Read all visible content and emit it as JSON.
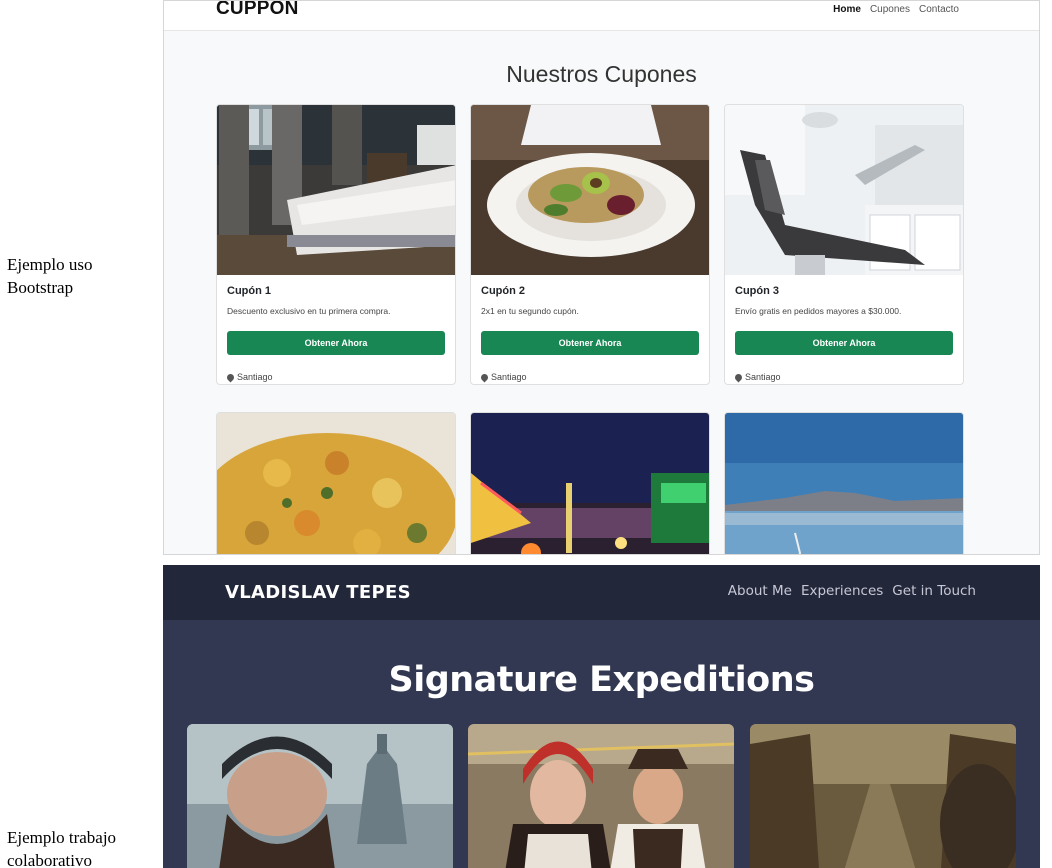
{
  "labels": {
    "bootstrap_line1": "Ejemplo uso",
    "bootstrap_line2": "Bootstrap",
    "collab_line1": "Ejemplo trabajo",
    "collab_line2": "colaborativo"
  },
  "cuppon": {
    "brand": "CUPPON",
    "nav": [
      "Home",
      "Cupones",
      "Contacto"
    ],
    "title": "Nuestros Cupones",
    "cards": [
      {
        "title": "Cupón 1",
        "text": "Descuento exclusivo en tu primera compra.",
        "button": "Obtener Ahora",
        "location": "Santiago"
      },
      {
        "title": "Cupón 2",
        "text": "2x1 en tu segundo cupón.",
        "button": "Obtener Ahora",
        "location": "Santiago"
      },
      {
        "title": "Cupón 3",
        "text": "Envío gratis en pedidos mayores a $30.000.",
        "button": "Obtener Ahora",
        "location": "Santiago"
      }
    ],
    "colors": {
      "button": "#198754",
      "background": "#f8f9fa"
    }
  },
  "tepes": {
    "brand": "VLADISLAV TEPES",
    "nav": [
      "About Me",
      "Experiences",
      "Get in Touch"
    ],
    "title": "Signature Expeditions",
    "colors": {
      "nav": "#23273a",
      "background": "#323752"
    }
  }
}
